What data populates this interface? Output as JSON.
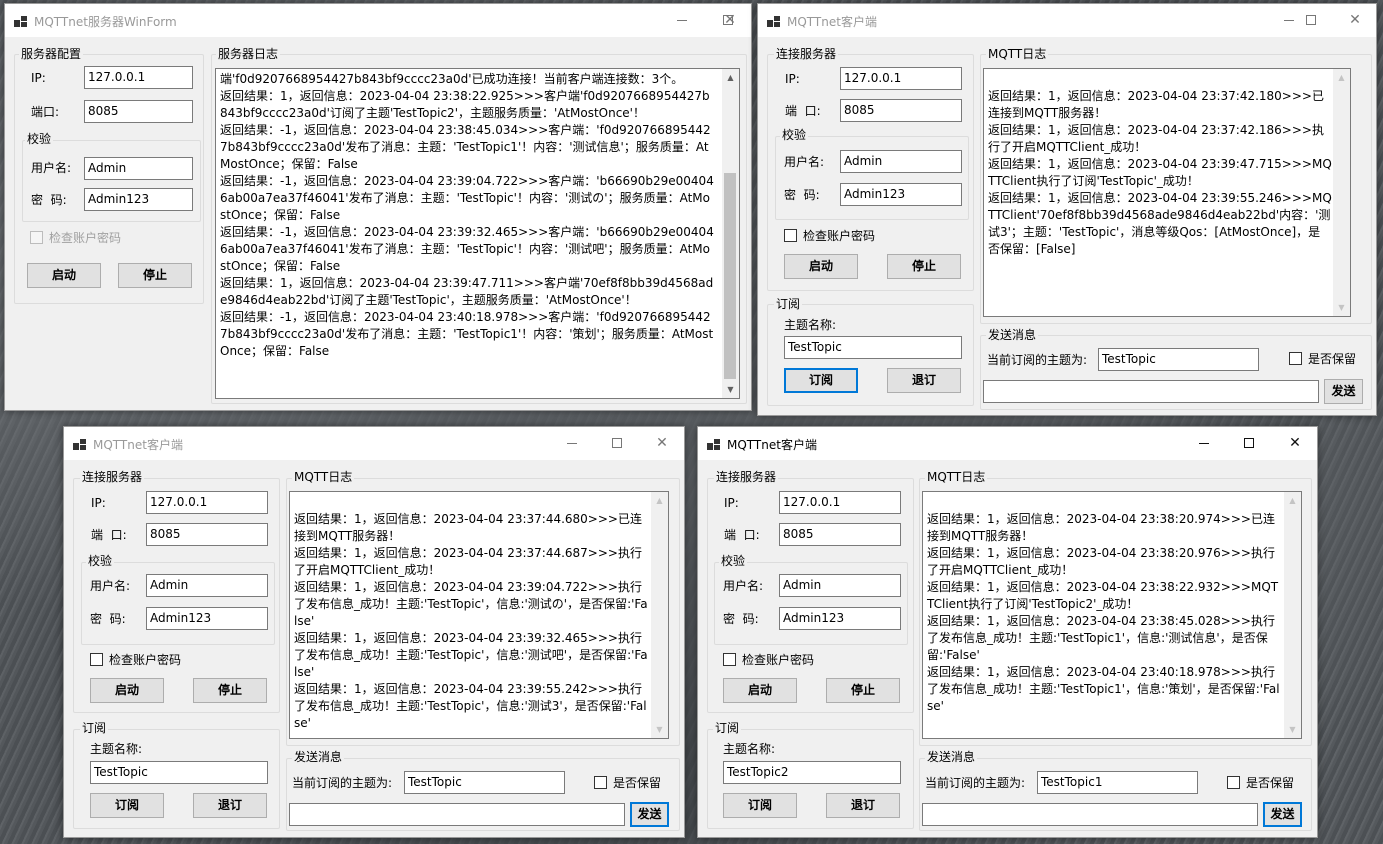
{
  "server": {
    "title": "MQTTnet服务器WinForm",
    "config_group": "服务器配置",
    "ip_label": "IP:",
    "ip_value": "127.0.0.1",
    "port_label": "端口:",
    "port_value": "8085",
    "verify_group": "校验",
    "user_label": "用户名:",
    "user_value": "Admin",
    "pwd_label": "密  码:",
    "pwd_value": "Admin123",
    "check_label": "检查账户密码",
    "start_label": "启动",
    "stop_label": "停止",
    "log_group": "服务器日志",
    "log": "端'f0d9207668954427b843bf9cccc23a0d'已成功连接！当前客户端连接数：3个。\n返回结果：1，返回信息：2023-04-04 23:38:22.925>>>客户端'f0d9207668954427b843bf9cccc23a0d'订阅了主题'TestTopic2'，主题服务质量：'AtMostOnce'！\n返回结果：-1，返回信息：2023-04-04 23:38:45.034>>>客户端：'f0d9207668954427b843bf9cccc23a0d'发布了消息：主题：'TestTopic1'！内容：'测试信息'；服务质量：AtMostOnce；保留：False\n返回结果：-1，返回信息：2023-04-04 23:39:04.722>>>客户端：'b66690b29e004046ab00a7ea37f46041'发布了消息：主题：'TestTopic'！内容：'测试の'；服务质量：AtMostOnce；保留：False\n返回结果：-1，返回信息：2023-04-04 23:39:32.465>>>客户端：'b66690b29e004046ab00a7ea37f46041'发布了消息：主题：'TestTopic'！内容：'测试吧'；服务质量：AtMostOnce；保留：False\n返回结果：1，返回信息：2023-04-04 23:39:47.711>>>客户端'70ef8f8bb39d4568ade9846d4eab22bd'订阅了主题'TestTopic'，主题服务质量：'AtMostOnce'！\n返回结果：-1，返回信息：2023-04-04 23:40:18.978>>>客户端：'f0d9207668954427b843bf9cccc23a0d'发布了消息：主题：'TestTopic1'！内容：'策划'；服务质量：AtMostOnce；保留：False"
  },
  "client_common": {
    "conn_group": "连接服务器",
    "ip_label": "IP:",
    "port_label": "端  口:",
    "verify_group": "校验",
    "user_label": "用户名:",
    "pwd_label": "密  码:",
    "check_label": "检查账户密码",
    "start_label": "启动",
    "stop_label": "停止",
    "sub_group": "订阅",
    "topic_label": "主题名称:",
    "sub_label": "订阅",
    "unsub_label": "退订",
    "log_group": "MQTT日志",
    "send_group": "发送消息",
    "current_label": "当前订阅的主题为:",
    "retain_label": "是否保留",
    "send_label": "发送"
  },
  "client1": {
    "title": "MQTTnet客户端",
    "ip_value": "127.0.0.1",
    "port_value": "8085",
    "user_value": "Admin",
    "pwd_value": "Admin123",
    "topic_value": "TestTopic",
    "current_topic": "TestTopic",
    "message_value": "",
    "log": "\n返回结果：1，返回信息：2023-04-04 23:37:42.180>>>已连接到MQTT服务器！\n返回结果：1，返回信息：2023-04-04 23:37:42.186>>>执行了开启MQTTClient_成功！\n返回结果：1，返回信息：2023-04-04 23:39:47.715>>>MQTTClient执行了订阅'TestTopic'_成功！\n返回结果：1，返回信息：2023-04-04 23:39:55.246>>>MQTTClient'70ef8f8bb39d4568ade9846d4eab22bd'内容：'测试3'；主题：'TestTopic'，消息等级Qos：[AtMostOnce]，是否保留：[False]"
  },
  "client2": {
    "title": "MQTTnet客户端",
    "ip_value": "127.0.0.1",
    "port_value": "8085",
    "user_value": "Admin",
    "pwd_value": "Admin123",
    "topic_value": "TestTopic",
    "current_topic": "TestTopic",
    "message_value": "",
    "log": "\n返回结果：1，返回信息：2023-04-04 23:37:44.680>>>已连接到MQTT服务器！\n返回结果：1，返回信息：2023-04-04 23:37:44.687>>>执行了开启MQTTClient_成功！\n返回结果：1，返回信息：2023-04-04 23:39:04.722>>>执行了发布信息_成功！主题:'TestTopic'，信息:'测试の'，是否保留:'False'\n返回结果：1，返回信息：2023-04-04 23:39:32.465>>>执行了发布信息_成功！主题:'TestTopic'，信息:'测试吧'，是否保留:'False'\n返回结果：1，返回信息：2023-04-04 23:39:55.242>>>执行了发布信息_成功！主题:'TestTopic'，信息:'测试3'，是否保留:'False'"
  },
  "client3": {
    "title": "MQTTnet客户端",
    "ip_value": "127.0.0.1",
    "port_value": "8085",
    "user_value": "Admin",
    "pwd_value": "Admin123",
    "topic_value": "TestTopic2",
    "current_topic": "TestTopic1",
    "message_value": "",
    "log": "\n返回结果：1，返回信息：2023-04-04 23:38:20.974>>>已连接到MQTT服务器！\n返回结果：1，返回信息：2023-04-04 23:38:20.976>>>执行了开启MQTTClient_成功！\n返回结果：1，返回信息：2023-04-04 23:38:22.932>>>MQTTClient执行了订阅'TestTopic2'_成功！\n返回结果：1，返回信息：2023-04-04 23:38:45.028>>>执行了发布信息_成功！主题:'TestTopic1'，信息:'测试信息'，是否保留:'False'\n返回结果：1，返回信息：2023-04-04 23:40:18.978>>>执行了发布信息_成功！主题:'TestTopic1'，信息:'策划'，是否保留:'False'"
  },
  "window_controls": {
    "minimize": "minimize-icon",
    "maximize": "maximize-icon",
    "close": "close-icon"
  },
  "colors": {
    "focus": "#0078d7",
    "window": "#f0f0f0",
    "titlebar": "#ffffff"
  }
}
